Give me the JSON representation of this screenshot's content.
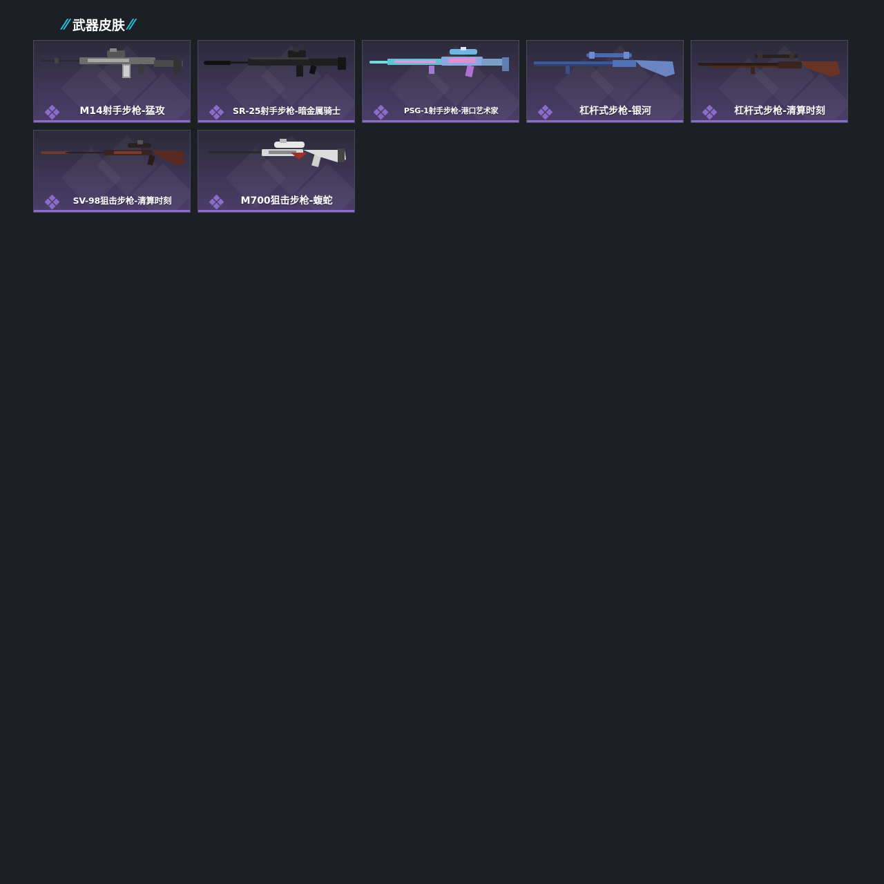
{
  "section": {
    "slashes_left": "//",
    "title": "武器皮肤",
    "slashes_right": "//"
  },
  "colors": {
    "background": "#1c2024",
    "accent": "#1fc9e8",
    "rarity": "#8a6dc9"
  },
  "skins": [
    {
      "name": "M14射手步枪-猛攻",
      "finish": "gray",
      "icon": "rarity-diamond-icon"
    },
    {
      "name": "SR-25射手步枪-暗金属骑士",
      "finish": "black",
      "icon": "rarity-diamond-icon"
    },
    {
      "name": "PSG-1射手步枪-港口艺术家",
      "finish": "cyan-pink",
      "icon": "rarity-diamond-icon"
    },
    {
      "name": "杠杆式步枪-银河",
      "finish": "blue",
      "icon": "rarity-diamond-icon"
    },
    {
      "name": "杠杆式步枪-清算时刻",
      "finish": "brown",
      "icon": "rarity-diamond-icon"
    },
    {
      "name": "SV-98狙击步枪-清算时刻",
      "finish": "dark-red",
      "icon": "rarity-diamond-icon"
    },
    {
      "name": "M700狙击步枪-蝮蛇",
      "finish": "white",
      "icon": "rarity-diamond-icon"
    }
  ]
}
